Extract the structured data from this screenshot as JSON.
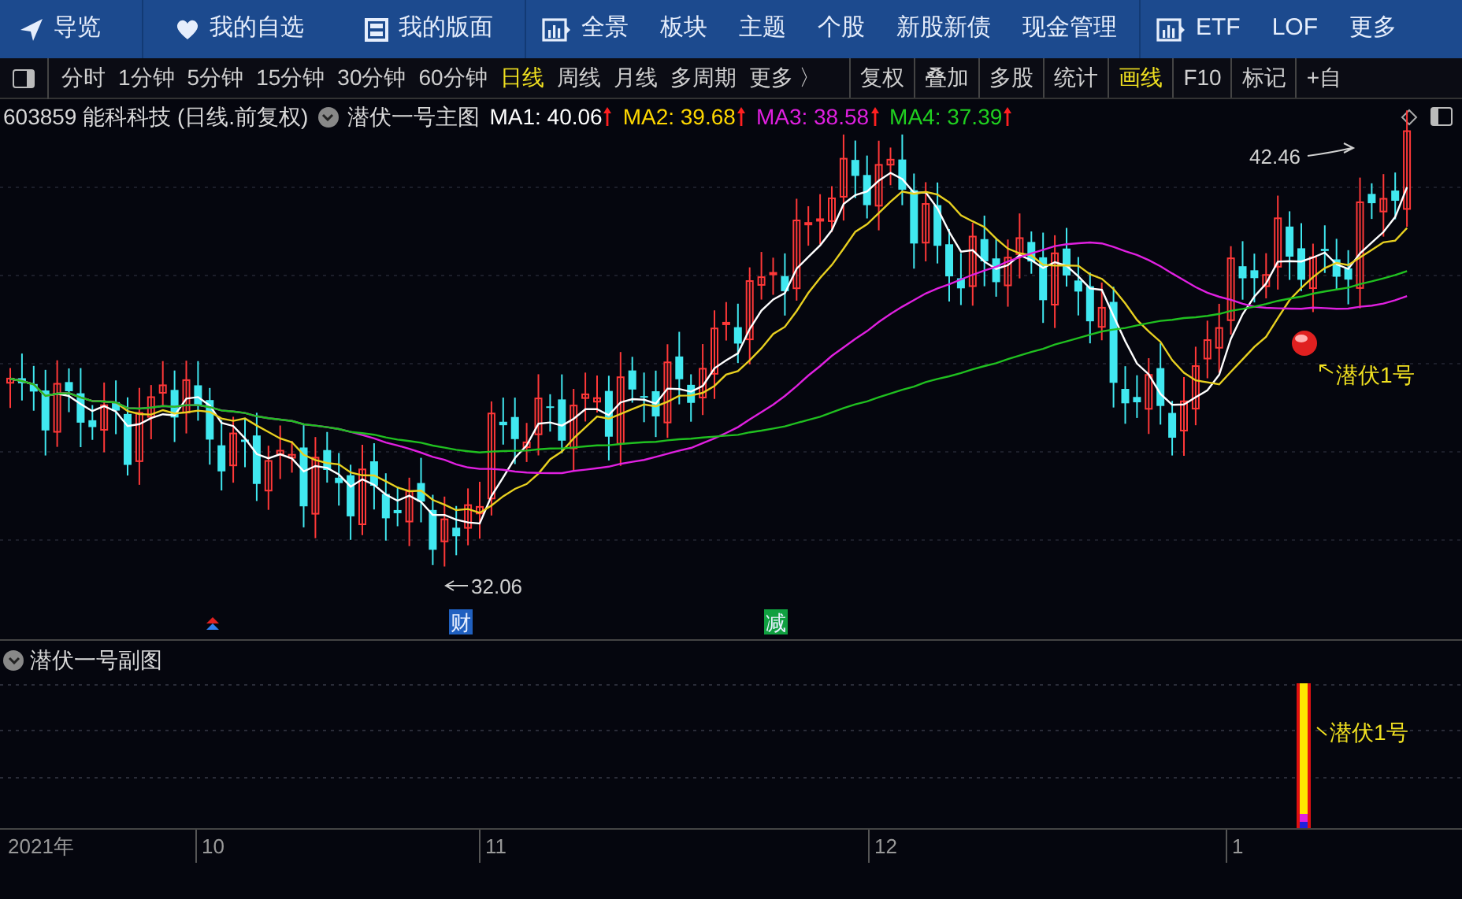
{
  "nav": [
    "导览",
    "我的自选",
    "我的版面",
    "全景",
    "板块",
    "主题",
    "个股",
    "新股新债",
    "现金管理",
    "ETF",
    "LOF",
    "更多"
  ],
  "periods": [
    {
      "label": "分时",
      "selected": false
    },
    {
      "label": "1分钟",
      "selected": false
    },
    {
      "label": "5分钟",
      "selected": false
    },
    {
      "label": "15分钟",
      "selected": false
    },
    {
      "label": "30分钟",
      "selected": false
    },
    {
      "label": "60分钟",
      "selected": false
    },
    {
      "label": "日线",
      "selected": true
    },
    {
      "label": "周线",
      "selected": false
    },
    {
      "label": "月线",
      "selected": false
    },
    {
      "label": "多周期",
      "selected": false
    },
    {
      "label": "更多 〉",
      "selected": false
    }
  ],
  "tools": [
    {
      "label": "复权",
      "selected": false
    },
    {
      "label": "叠加",
      "selected": false
    },
    {
      "label": "多股",
      "selected": false
    },
    {
      "label": "统计",
      "selected": false
    },
    {
      "label": "画线",
      "selected": true
    },
    {
      "label": "F10",
      "selected": false
    },
    {
      "label": "标记",
      "selected": false
    },
    {
      "label": "+自",
      "selected": false
    }
  ],
  "main_chart": {
    "stock": "603859 能科科技 (日线.前复权)",
    "indicator": "潜伏一号主图",
    "ma": [
      {
        "label": "MA1: 40.06",
        "color": "#ffffff"
      },
      {
        "label": "MA2: 39.68",
        "color": "#ffd800"
      },
      {
        "label": "MA3: 38.58",
        "color": "#e020e0"
      },
      {
        "label": "MA4: 37.39",
        "color": "#20d020"
      }
    ],
    "high_label": "42.46",
    "low_label": "32.06",
    "signal_label": "潜伏1号",
    "events": [
      {
        "kind": "arrows"
      },
      {
        "kind": "text",
        "text": "财",
        "color": "#2060c0"
      },
      {
        "kind": "text",
        "text": "减",
        "color": "#10a040"
      }
    ]
  },
  "sub_chart": {
    "title": "潜伏一号副图",
    "signal_label": "潜伏1号"
  },
  "x_axis": [
    "2021年",
    "10",
    "11",
    "12",
    "1"
  ]
}
